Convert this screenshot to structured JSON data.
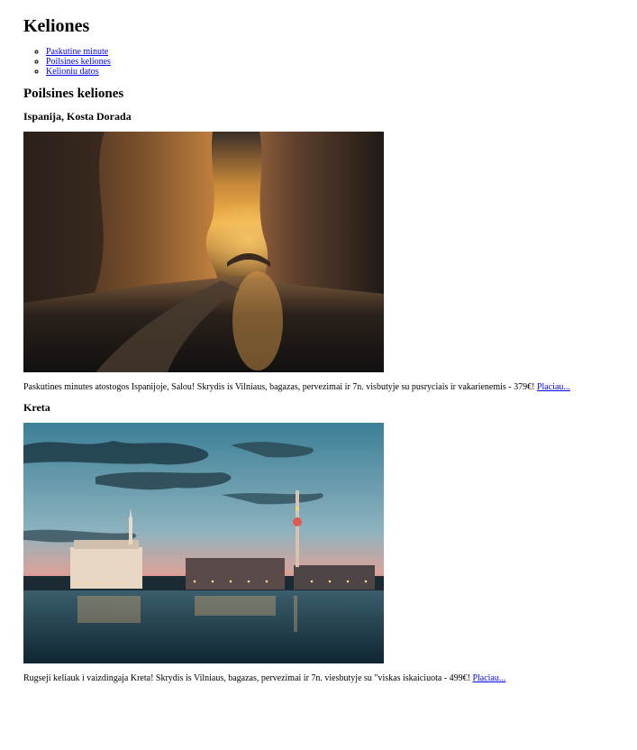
{
  "site_title": "Keliones",
  "nav": {
    "items": [
      {
        "label": "Paskutine minute"
      },
      {
        "label": "Poilsines keliones"
      },
      {
        "label": "Kelioniu datos"
      }
    ]
  },
  "section_title": "Poilsines keliones",
  "offers": [
    {
      "title": "Ispanija, Kosta Dorada",
      "image": "canyon-river-sunset",
      "description": "Paskutines minutes atostogos Ispanijoje, Salou! Skrydis is Vilniaus, bagazas, pervezimai ir 7n. visbutyje su pusryciais ir vakarienemis - 379€!",
      "link_text": "Placiau..."
    },
    {
      "title": "Kreta",
      "image": "city-waterfront-dusk",
      "description": "Rugseji keliauk i vaizdingaja Kreta! Skrydis is Vilniaus, bagazas, pervezimai ir 7n. viesbutyje su \"viskas iskaiciuota - 499€!",
      "link_text": "Placiau..."
    }
  ]
}
